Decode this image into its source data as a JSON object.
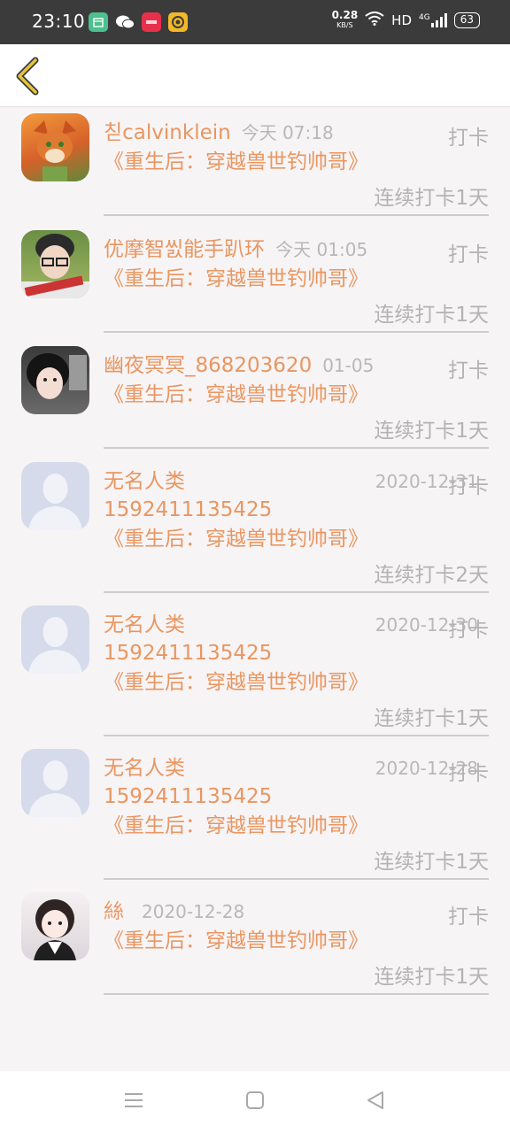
{
  "status_bar": {
    "time": "23:10",
    "net_speed": "0.28",
    "net_unit": "KB/S",
    "hd": "HD",
    "signal": "4G",
    "battery": "63",
    "apps": [
      "calendar-app-icon",
      "wechat-icon",
      "red-app-icon",
      "yellow-app-icon"
    ]
  },
  "header": {
    "back_icon": "chevron-left-icon",
    "accent": "#e5c33a"
  },
  "items": [
    {
      "name": "칟calvinklein",
      "time": "今天 07:18",
      "phone": "",
      "book": "《重生后：穿越兽世钓帅哥》",
      "tag": "打卡",
      "streak": "连续打卡1天",
      "avatar": "fox-cartoon-avatar"
    },
    {
      "name": "优摩智씴能手趴环",
      "time": "今天 01:05",
      "phone": "",
      "book": "《重生后：穿越兽世钓帅哥》",
      "tag": "打卡",
      "streak": "连续打卡1天",
      "avatar": "boy-glasses-avatar"
    },
    {
      "name": "幽夜冥冥_868203620",
      "time": "01-05",
      "phone": "",
      "book": "《重生后：穿越兽世钓帅哥》",
      "tag": "打卡",
      "streak": "连续打卡1天",
      "avatar": "girl-photo-avatar"
    },
    {
      "name": "无名人类",
      "time": "2020-12-31",
      "phone": "1592411135425",
      "book": "《重生后：穿越兽世钓帅哥》",
      "tag": "打卡",
      "streak": "连续打卡2天",
      "avatar": "default-avatar"
    },
    {
      "name": "无名人类",
      "time": "2020-12-30",
      "phone": "1592411135425",
      "book": "《重生后：穿越兽世钓帅哥》",
      "tag": "打卡",
      "streak": "连续打卡1天",
      "avatar": "default-avatar"
    },
    {
      "name": "无名人类",
      "time": "2020-12-28",
      "phone": "1592411135425",
      "book": "《重生后：穿越兽世钓帅哥》",
      "tag": "打卡",
      "streak": "连续打卡1天",
      "avatar": "default-avatar"
    },
    {
      "name": "絲",
      "time": "2020-12-28",
      "phone": "",
      "book": "《重生后：穿越兽世钓帅哥》",
      "tag": "打卡",
      "streak": "连续打卡1天",
      "avatar": "girl-anime-avatar"
    }
  ],
  "nav": {
    "menu": "menu-icon",
    "home": "home-icon",
    "back": "back-triangle-icon"
  }
}
